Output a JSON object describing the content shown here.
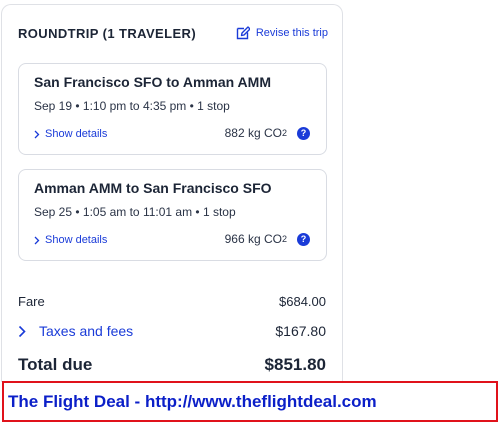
{
  "trip": {
    "title": "ROUNDTRIP (1 TRAVELER)",
    "revise_label": "Revise this trip"
  },
  "flights": [
    {
      "route": "San Francisco SFO to Amman AMM",
      "times": "Sep 19 • 1:10 pm to 4:35 pm • 1 stop",
      "details_label": "Show details",
      "co2_value": "882 kg CO",
      "co2_sub": "2"
    },
    {
      "route": "Amman AMM to San Francisco SFO",
      "times": "Sep 25 • 1:05 am to 11:01 am • 1 stop",
      "details_label": "Show details",
      "co2_value": "966 kg CO",
      "co2_sub": "2"
    }
  ],
  "pricing": {
    "fare_label": "Fare",
    "fare_value": "$684.00",
    "taxes_label": "Taxes and fees",
    "taxes_value": "$167.80",
    "total_label": "Total due",
    "total_value": "$851.80"
  },
  "watermark": {
    "text": "The Flight Deal - http://www.theflightdeal.com"
  },
  "icons": {
    "edit": "edit-icon",
    "chevron": "chevron-right-icon",
    "help": "question-icon"
  },
  "colors": {
    "accent": "#1a3bd8",
    "text": "#1c2536",
    "watermark_border": "#e0121b",
    "watermark_text": "#0b1fc8"
  }
}
